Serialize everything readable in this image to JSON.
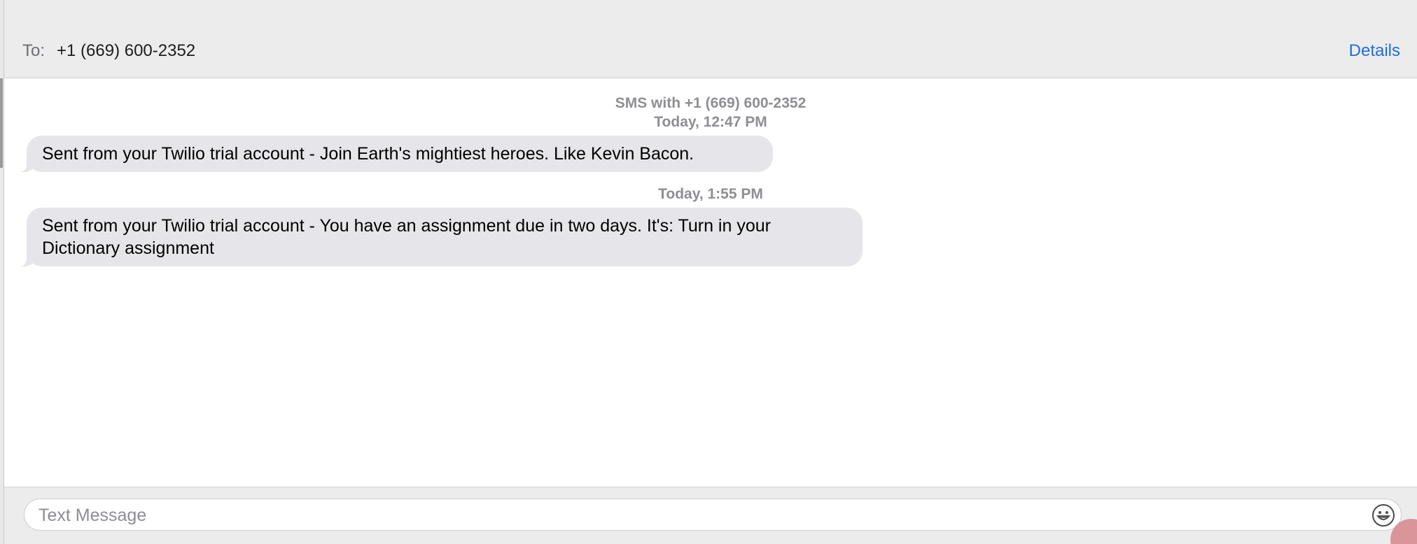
{
  "header": {
    "to_label": "To:",
    "to_value": "+1 (669) 600-2352",
    "details_label": "Details"
  },
  "conversation": {
    "service_line": "SMS with +1 (669) 600-2352",
    "messages": [
      {
        "timestamp": "Today, 12:47 PM",
        "text": "Sent from your Twilio trial account - Join Earth's mightiest heroes. Like Kevin Bacon."
      },
      {
        "timestamp": "Today, 1:55 PM",
        "text": "Sent from your Twilio trial account - You have an assignment due in two days. It's: Turn in your Dictionary assignment"
      }
    ]
  },
  "composer": {
    "placeholder": "Text Message",
    "value": "",
    "emoji_icon": "smiley-face-icon"
  },
  "colors": {
    "accent": "#1f6fd6",
    "incoming_bubble": "#e5e5ea",
    "meta_text": "#8e8e93"
  }
}
